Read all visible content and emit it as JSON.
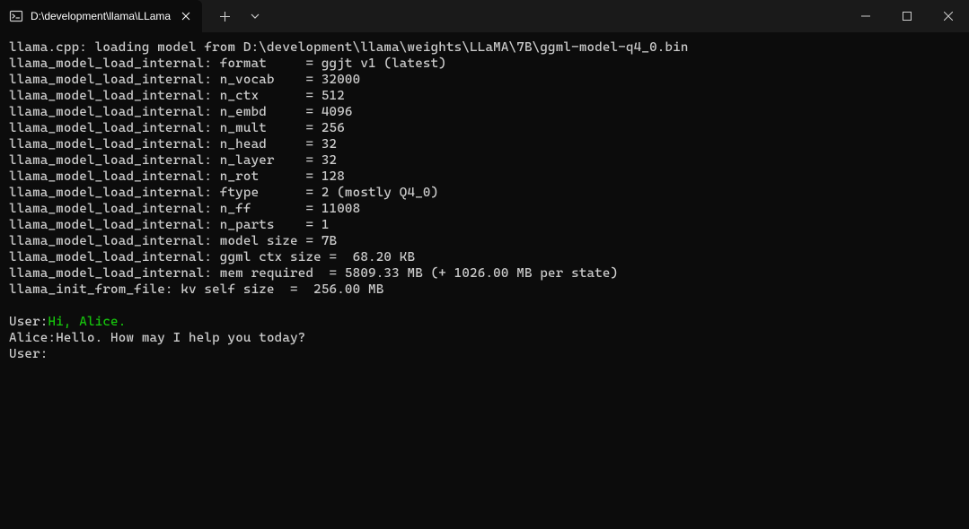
{
  "titlebar": {
    "tab_title": "D:\\development\\llama\\LLama",
    "tab_icon": "terminal-icon"
  },
  "terminal": {
    "lines": [
      "llama.cpp: loading model from D:\\development\\llama\\weights\\LLaMA\\7B\\ggml-model-q4_0.bin",
      "llama_model_load_internal: format     = ggjt v1 (latest)",
      "llama_model_load_internal: n_vocab    = 32000",
      "llama_model_load_internal: n_ctx      = 512",
      "llama_model_load_internal: n_embd     = 4096",
      "llama_model_load_internal: n_mult     = 256",
      "llama_model_load_internal: n_head     = 32",
      "llama_model_load_internal: n_layer    = 32",
      "llama_model_load_internal: n_rot      = 128",
      "llama_model_load_internal: ftype      = 2 (mostly Q4_0)",
      "llama_model_load_internal: n_ff       = 11008",
      "llama_model_load_internal: n_parts    = 1",
      "llama_model_load_internal: model size = 7B",
      "llama_model_load_internal: ggml ctx size =  68.20 KB",
      "llama_model_load_internal: mem required  = 5809.33 MB (+ 1026.00 MB per state)",
      "llama_init_from_file: kv self size  =  256.00 MB"
    ],
    "chat": {
      "user1_prefix": "User:",
      "user1_input": "Hi, Alice.",
      "alice_prefix": "Alice:",
      "alice_reply": "Hello. How may I help you today?",
      "user2_prefix": "User:"
    }
  }
}
